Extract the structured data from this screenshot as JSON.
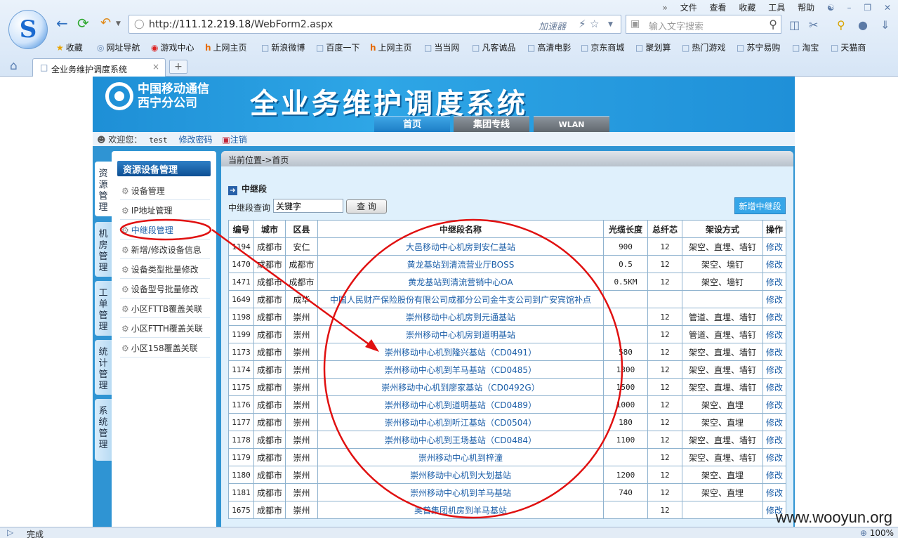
{
  "browser": {
    "menu": [
      "文件",
      "查看",
      "收藏",
      "工具",
      "帮助"
    ],
    "url_prefix": "http://",
    "url_host": "111.12.219.18",
    "url_path": "/WebForm2.aspx",
    "accelerator": "加速器",
    "search_placeholder": "输入文字搜索",
    "favorites": [
      {
        "icon": "star-icon",
        "label": "收藏"
      },
      {
        "icon": "globe-icon",
        "label": "网址导航"
      },
      {
        "icon": "game-icon",
        "label": "游戏中心"
      },
      {
        "icon": "hao-icon",
        "label": "上网主页"
      },
      {
        "icon": "page-icon",
        "label": "新浪微博"
      },
      {
        "icon": "page-icon",
        "label": "百度一下"
      },
      {
        "icon": "hao-icon",
        "label": "上网主页"
      },
      {
        "icon": "page-icon",
        "label": "当当网"
      },
      {
        "icon": "page-icon",
        "label": "凡客诚品"
      },
      {
        "icon": "page-icon",
        "label": "高清电影"
      },
      {
        "icon": "page-icon",
        "label": "京东商城"
      },
      {
        "icon": "page-icon",
        "label": "聚划算"
      },
      {
        "icon": "page-icon",
        "label": "热门游戏"
      },
      {
        "icon": "page-icon",
        "label": "苏宁易购"
      },
      {
        "icon": "page-icon",
        "label": "淘宝"
      },
      {
        "icon": "page-icon",
        "label": "天猫商"
      }
    ],
    "tab_title": "全业务维护调度系统",
    "status_text": "完成",
    "zoom": "100%",
    "watermark": "www.wooyun.org"
  },
  "site": {
    "company_line1": "中国移动通信",
    "company_line2": "西宁分公司",
    "system_title": "全业务维护调度系统",
    "nav": [
      "首页",
      "集团专线",
      "WLAN"
    ],
    "welcome": "欢迎您：",
    "username": "test",
    "change_password": "修改密码",
    "logout": "注销"
  },
  "left_tabs": [
    "资源管理",
    "机房管理",
    "工单管理",
    "统计管理",
    "系统管理"
  ],
  "side_menu": {
    "title": "资源设备管理",
    "items": [
      "设备管理",
      "IP地址管理",
      "中继段管理",
      "新增/修改设备信息",
      "设备类型批量修改",
      "设备型号批量修改",
      "小区FTTB覆盖关联",
      "小区FTTH覆盖关联",
      "小区158覆盖关联"
    ]
  },
  "content": {
    "breadcrumb": "当前位置->首页",
    "title": "中继段",
    "query_label": "中继段查询",
    "query_value": "关键字",
    "query_button": "查 询",
    "add_button": "新增中继段",
    "columns": [
      "编号",
      "城市",
      "区县",
      "中继段名称",
      "光缆长度",
      "总纤芯",
      "架设方式",
      "操作"
    ],
    "rows": [
      [
        "1194",
        "成都市",
        "安仁",
        "大邑移动中心机房到安仁基站",
        "900",
        "12",
        "架空、直埋、墙钉",
        "修改"
      ],
      [
        "1470",
        "成都市",
        "成都市",
        "黄龙基站到清流营业厅BOSS",
        "0.5",
        "12",
        "架空、墙钉",
        "修改"
      ],
      [
        "1471",
        "成都市",
        "成都市",
        "黄龙基站到清流营销中心OA",
        "0.5KM",
        "12",
        "架空、墙钉",
        "修改"
      ],
      [
        "1649",
        "成都市",
        "成华",
        "中国人民财产保险股份有限公司成都分公司金牛支公司到广安宾馆补点",
        "",
        "",
        "",
        "修改"
      ],
      [
        "1198",
        "成都市",
        "崇州",
        "崇州移动中心机房到元通基站",
        "",
        "12",
        "管道、直埋、墙钉",
        "修改"
      ],
      [
        "1199",
        "成都市",
        "崇州",
        "崇州移动中心机房到道明基站",
        "",
        "12",
        "管道、直埋、墙钉",
        "修改"
      ],
      [
        "1173",
        "成都市",
        "崇州",
        "崇州移动中心机到隆兴基站（CD0491）",
        "580",
        "12",
        "架空、直埋、墙钉",
        "修改"
      ],
      [
        "1174",
        "成都市",
        "崇州",
        "崇州移动中心机到羊马基站（CD0485）",
        "1300",
        "12",
        "架空、直埋、墙钉",
        "修改"
      ],
      [
        "1175",
        "成都市",
        "崇州",
        "崇州移动中心机到廖家基站（CD0492G）",
        "1500",
        "12",
        "架空、直埋、墙钉",
        "修改"
      ],
      [
        "1176",
        "成都市",
        "崇州",
        "崇州移动中心机到道明基站（CD0489）",
        "1000",
        "12",
        "架空、直埋",
        "修改"
      ],
      [
        "1177",
        "成都市",
        "崇州",
        "崇州移动中心机到听江基站（CD0504）",
        "180",
        "12",
        "架空、直埋",
        "修改"
      ],
      [
        "1178",
        "成都市",
        "崇州",
        "崇州移动中心机到王场基站（CD0484）",
        "1100",
        "12",
        "架空、直埋、墙钉",
        "修改"
      ],
      [
        "1179",
        "成都市",
        "崇州",
        "崇州移动中心机到梓潼",
        "",
        "12",
        "架空、直埋、墙钉",
        "修改"
      ],
      [
        "1180",
        "成都市",
        "崇州",
        "崇州移动中心机到大划基站",
        "1200",
        "12",
        "架空、直埋",
        "修改"
      ],
      [
        "1181",
        "成都市",
        "崇州",
        "崇州移动中心机到羊马基站",
        "740",
        "12",
        "架空、直埋",
        "修改"
      ],
      [
        "1675",
        "成都市",
        "崇州",
        "奥普集团机房到羊马基站",
        "",
        "12",
        "",
        "修改"
      ]
    ]
  },
  "colors": {
    "banner_blue": "#2ea6e6",
    "annotation_red": "#e01010",
    "link_blue": "#1b5ea8"
  }
}
